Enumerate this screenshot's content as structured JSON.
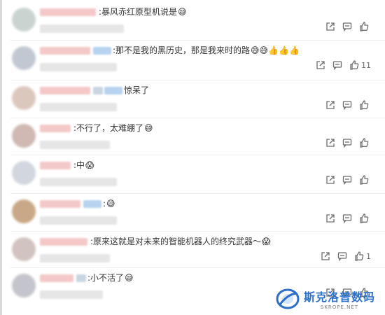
{
  "comments": [
    {
      "text": ":暴风赤红原型机说是",
      "emoji": "😅",
      "badges": [],
      "likes": ""
    },
    {
      "text": ":那不是我的黑历史，那是我来时的路",
      "emoji": "😅😅👍👍👍",
      "badges": [
        "b"
      ],
      "likes": "11"
    },
    {
      "text": "惊呆了",
      "emoji": "",
      "badges": [
        "g",
        "b"
      ],
      "likes": ""
    },
    {
      "text": ":不行了，太难绷了",
      "emoji": "😅",
      "badges": [],
      "likes": ""
    },
    {
      "text": ":中",
      "emoji": "😱",
      "badges": [],
      "likes": ""
    },
    {
      "text": ":",
      "emoji": "😅",
      "badges": [
        "b"
      ],
      "likes": ""
    },
    {
      "text": ":原来这就是对未来的智能机器人的终究武器～",
      "emoji": "😱",
      "badges": [],
      "likes": "1"
    },
    {
      "text": ":小不活了",
      "emoji": "😅",
      "badges": [
        "g"
      ],
      "likes": ""
    }
  ],
  "icons": {
    "share": "share-icon",
    "reply": "comment-icon",
    "like": "thumbs-up-icon"
  },
  "watermark": {
    "cn": "斯克洛普数码",
    "en": "SKROPE.NET"
  },
  "colors": {
    "accent": "#2b6fc9",
    "username": "#f4c8c8"
  }
}
